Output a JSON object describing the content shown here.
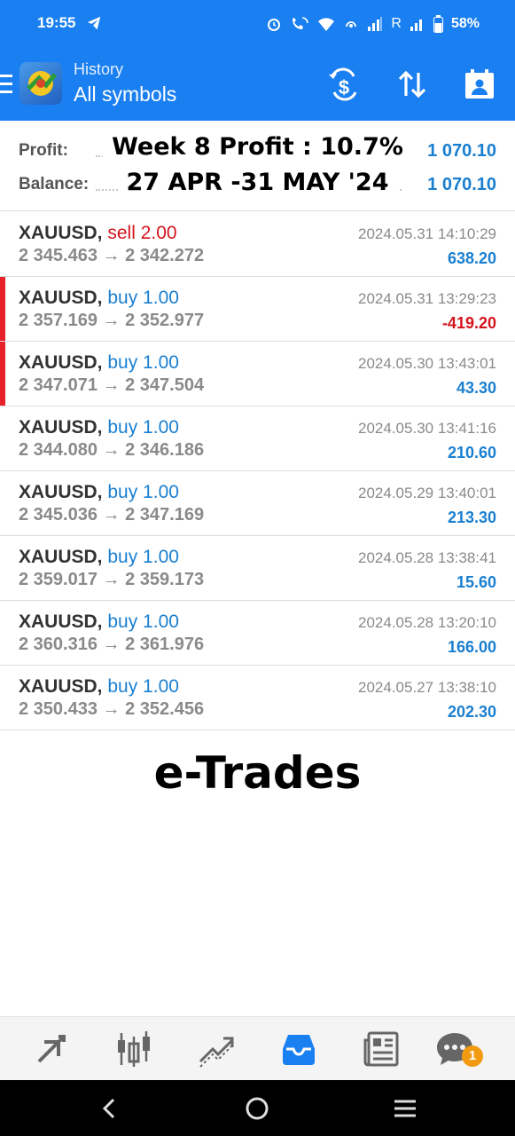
{
  "status_bar": {
    "time": "19:55",
    "network_label": "R",
    "battery": "58%"
  },
  "header": {
    "subtitle": "History",
    "title": "All symbols",
    "icons": [
      "menu-icon",
      "app-logo",
      "currency-filter-icon",
      "sort-icon",
      "calendar-icon"
    ]
  },
  "summary": {
    "profit_label": "Profit:",
    "profit_value": "1 070.10",
    "balance_label": "Balance:",
    "balance_value": "1 070.10"
  },
  "overlay": {
    "line1": "Week 8 Profit : 10.7%",
    "line2": "27 APR -31 MAY '24"
  },
  "deals": [
    {
      "symbol": "XAUUSD,",
      "side": "sell 2.00",
      "side_type": "sell",
      "open": "2 345.463",
      "arrow": "→",
      "close": "2 342.272",
      "time": "2024.05.31 14:10:29",
      "profit": "638.20",
      "profit_type": "pos",
      "marked": false
    },
    {
      "symbol": "XAUUSD,",
      "side": "buy 1.00",
      "side_type": "buy",
      "open": "2 357.169",
      "arrow": "→",
      "close": "2 352.977",
      "time": "2024.05.31 13:29:23",
      "profit": "-419.20",
      "profit_type": "neg",
      "marked": true
    },
    {
      "symbol": "XAUUSD,",
      "side": "buy 1.00",
      "side_type": "buy",
      "open": "2 347.071",
      "arrow": "→",
      "close": "2 347.504",
      "time": "2024.05.30 13:43:01",
      "profit": "43.30",
      "profit_type": "pos",
      "marked": true
    },
    {
      "symbol": "XAUUSD,",
      "side": "buy 1.00",
      "side_type": "buy",
      "open": "2 344.080",
      "arrow": "→",
      "close": "2 346.186",
      "time": "2024.05.30 13:41:16",
      "profit": "210.60",
      "profit_type": "pos",
      "marked": false
    },
    {
      "symbol": "XAUUSD,",
      "side": "buy 1.00",
      "side_type": "buy",
      "open": "2 345.036",
      "arrow": "→",
      "close": "2 347.169",
      "time": "2024.05.29 13:40:01",
      "profit": "213.30",
      "profit_type": "pos",
      "marked": false
    },
    {
      "symbol": "XAUUSD,",
      "side": "buy 1.00",
      "side_type": "buy",
      "open": "2 359.017",
      "arrow": "→",
      "close": "2 359.173",
      "time": "2024.05.28 13:38:41",
      "profit": "15.60",
      "profit_type": "pos",
      "marked": false
    },
    {
      "symbol": "XAUUSD,",
      "side": "buy 1.00",
      "side_type": "buy",
      "open": "2 360.316",
      "arrow": "→",
      "close": "2 361.976",
      "time": "2024.05.28 13:20:10",
      "profit": "166.00",
      "profit_type": "pos",
      "marked": false
    },
    {
      "symbol": "XAUUSD,",
      "side": "buy 1.00",
      "side_type": "buy",
      "open": "2 350.433",
      "arrow": "→",
      "close": "2 352.456",
      "time": "2024.05.27 13:38:10",
      "profit": "202.30",
      "profit_type": "pos",
      "marked": false
    }
  ],
  "brand_text": "e-Trades",
  "bottom_nav": {
    "items": [
      "quotes-icon",
      "chart-icon",
      "trade-icon",
      "history-icon",
      "news-icon",
      "chat-icon"
    ],
    "active": "history-icon",
    "chat_badge": "1"
  },
  "colors": {
    "header_bg": "#1a7ff0",
    "buy": "#1a7fd0",
    "sell": "#d4141c",
    "marker": "#e8202a",
    "badge": "#f19a12"
  }
}
